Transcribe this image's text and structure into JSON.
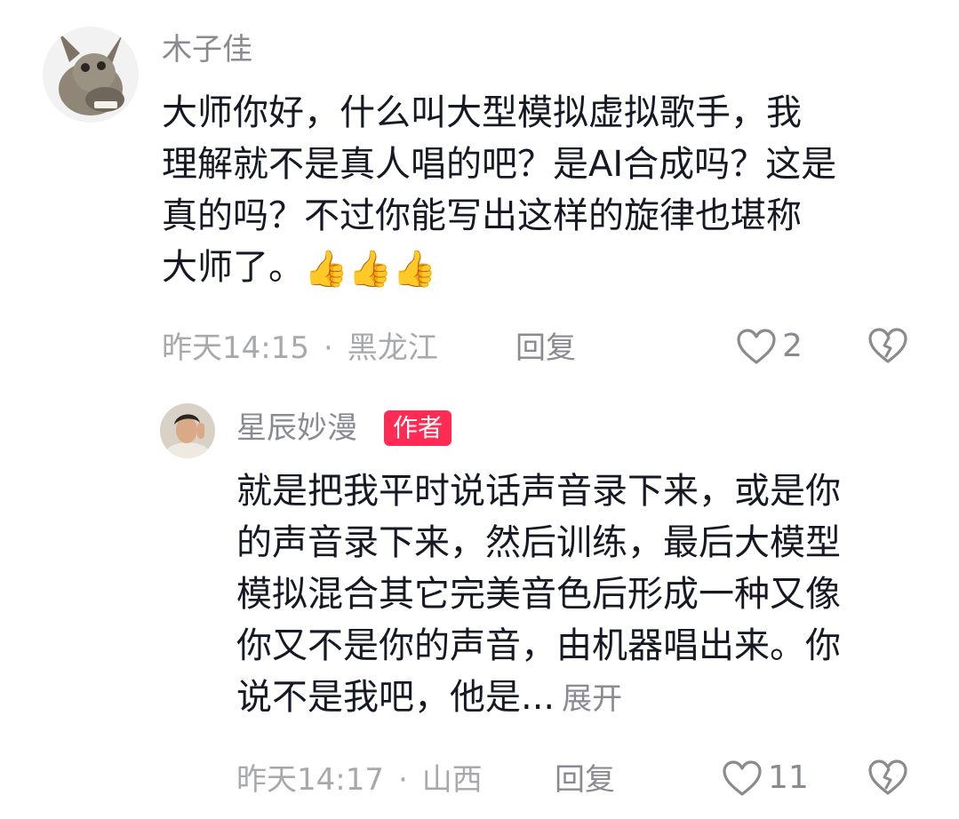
{
  "comments": [
    {
      "username": "木子佳",
      "avatar": "donkey-avatar",
      "lines": [
        "大师你好，什么叫大型模拟虚拟歌手，我",
        "理解就不是真人唱的吧？是AI合成吗？这是",
        "真的吗？不过你能写出这样的旋律也堪称",
        "大师了。"
      ],
      "emoji": "👍👍👍",
      "time": "昨天14:15",
      "separator": "·",
      "location": "黑龙江",
      "reply_label": "回复",
      "like_count": "2"
    }
  ],
  "replies": [
    {
      "username": "星辰妙漫",
      "badge": "作者",
      "avatar": "man-avatar",
      "lines": [
        "就是把我平时说话声音录下来，或是你",
        "的声音录下来，然后训练，最后大模型",
        "模拟混合其它完美音色后形成一种又像",
        "你又不是你的声音，由机器唱出来。你",
        "说不是我吧，他是..."
      ],
      "expand_label": "展开",
      "time": "昨天14:17",
      "separator": "·",
      "location": "山西",
      "reply_label": "回复",
      "like_count": "11"
    }
  ],
  "colors": {
    "text": "#161823",
    "meta": "#a8a9ad",
    "username": "#8a8b91",
    "badge": "#fe2c55"
  }
}
